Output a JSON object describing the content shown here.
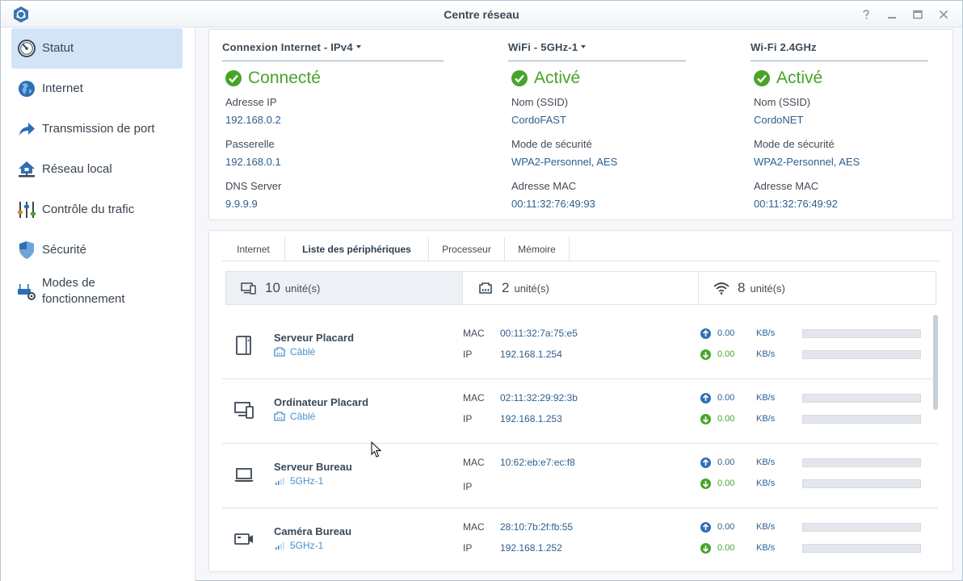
{
  "window": {
    "title": "Centre réseau"
  },
  "sidebar": {
    "items": [
      {
        "label": "Statut",
        "icon": "gauge-icon",
        "active": true
      },
      {
        "label": "Internet",
        "icon": "globe-icon",
        "active": false
      },
      {
        "label": "Transmission de port",
        "icon": "forward-arrow-icon",
        "active": false
      },
      {
        "label": "Réseau local",
        "icon": "home-network-icon",
        "active": false
      },
      {
        "label": "Contrôle du trafic",
        "icon": "sliders-icon",
        "active": false
      },
      {
        "label": "Sécurité",
        "icon": "shield-icon",
        "active": false
      },
      {
        "label": "Modes de fonctionnement",
        "icon": "router-gear-icon",
        "active": false
      }
    ]
  },
  "connection": {
    "internet": {
      "header": "Connexion Internet - IPv4",
      "status": "Connecté",
      "f1_label": "Adresse IP",
      "f1_value": "192.168.0.2",
      "f2_label": "Passerelle",
      "f2_value": "192.168.0.1",
      "f3_label": "DNS Server",
      "f3_value": "9.9.9.9"
    },
    "wifi5": {
      "header": "WiFi - 5GHz-1",
      "status": "Activé",
      "f1_label": "Nom (SSID)",
      "f1_value": "CordoFAST",
      "f2_label": "Mode de sécurité",
      "f2_value": "WPA2-Personnel, AES",
      "f3_label": "Adresse MAC",
      "f3_value": "00:11:32:76:49:93"
    },
    "wifi24": {
      "header": "Wi-Fi 2.4GHz",
      "status": "Activé",
      "f1_label": "Nom (SSID)",
      "f1_value": "CordoNET",
      "f2_label": "Mode de sécurité",
      "f2_value": "WPA2-Personnel, AES",
      "f3_label": "Adresse MAC",
      "f3_value": "00:11:32:76:49:92"
    }
  },
  "tabs": [
    {
      "label": "Internet",
      "active": false
    },
    {
      "label": "Liste des périphériques",
      "active": true
    },
    {
      "label": "Processeur",
      "active": false
    },
    {
      "label": "Mémoire",
      "active": false
    }
  ],
  "summary": [
    {
      "icon": "devices-icon",
      "count": "10",
      "unit": "unité(s)"
    },
    {
      "icon": "ethernet-icon",
      "count": "2",
      "unit": "unité(s)"
    },
    {
      "icon": "wifi-icon",
      "count": "8",
      "unit": "unité(s)"
    }
  ],
  "labels": {
    "mac": "MAC",
    "ip": "IP",
    "rate_unit": "KB/s"
  },
  "devices": [
    {
      "name": "Serveur Placard",
      "conn": "Câblé",
      "conn_icon": "ethernet-port-icon",
      "icon": "server-icon",
      "mac": "00:11:32:7a:75:e5",
      "ip": "192.168.1.254",
      "up": "0.00",
      "down": "0.00",
      "up_fill": 0,
      "down_fill": 0
    },
    {
      "name": "Ordinateur Placard",
      "conn": "Câblé",
      "conn_icon": "ethernet-port-icon",
      "icon": "computer-icon",
      "mac": "02:11:32:29:92:3b",
      "ip": "192.168.1.253",
      "up": "0.00",
      "down": "0.00",
      "up_fill": 0,
      "down_fill": 0
    },
    {
      "name": "Serveur Bureau",
      "conn": "5GHz-1",
      "conn_icon": "signal-icon",
      "icon": "laptop-icon",
      "mac": "10:62:eb:e7:ec:f8",
      "ip": "",
      "up": "0.00",
      "down": "0.00",
      "up_fill": 0,
      "down_fill": 0
    },
    {
      "name": "Caméra Bureau",
      "conn": "5GHz-1",
      "conn_icon": "signal-icon",
      "icon": "camera-icon",
      "mac": "28:10:7b:2f:fb:55",
      "ip": "192.168.1.252",
      "up": "0.00",
      "down": "0.00",
      "up_fill": 0,
      "down_fill": 0
    }
  ],
  "colors": {
    "accent": "#4a90c9",
    "ok": "#48a429",
    "active_bg": "#d3e4f7"
  }
}
